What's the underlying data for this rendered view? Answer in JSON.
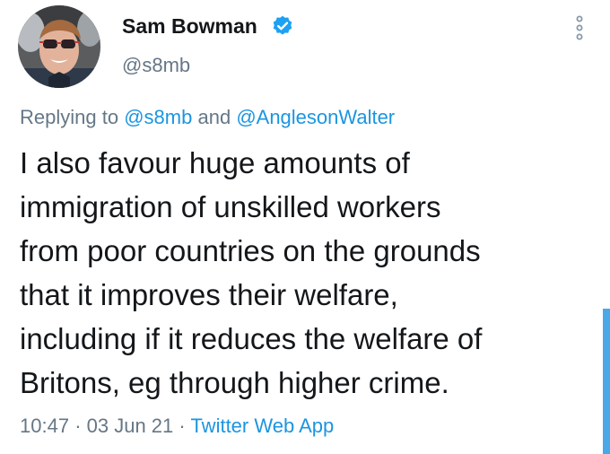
{
  "author": {
    "display_name": "Sam Bowman",
    "handle": "@s8mb",
    "verified": true
  },
  "reply": {
    "prefix": "Replying to",
    "mention_1": "@s8mb",
    "conjunction": "and",
    "mention_2": "@AnglesonWalter"
  },
  "tweet": {
    "lines": [
      "I also favour huge amounts of",
      "immigration of unskilled workers",
      "from poor countries on the grounds",
      "that it improves their welfare,",
      "including if it reduces the welfare of",
      "Britons, eg through higher crime."
    ]
  },
  "meta": {
    "time": "10:47",
    "separator": "·",
    "date": "03 Jun 21",
    "source": "Twitter Web App"
  },
  "icons": {
    "verified": "verified-badge-icon",
    "more": "more-options-icon"
  },
  "colors": {
    "accent": "#1b95e0",
    "secondary_text": "#657786",
    "primary_text": "#14171a"
  }
}
